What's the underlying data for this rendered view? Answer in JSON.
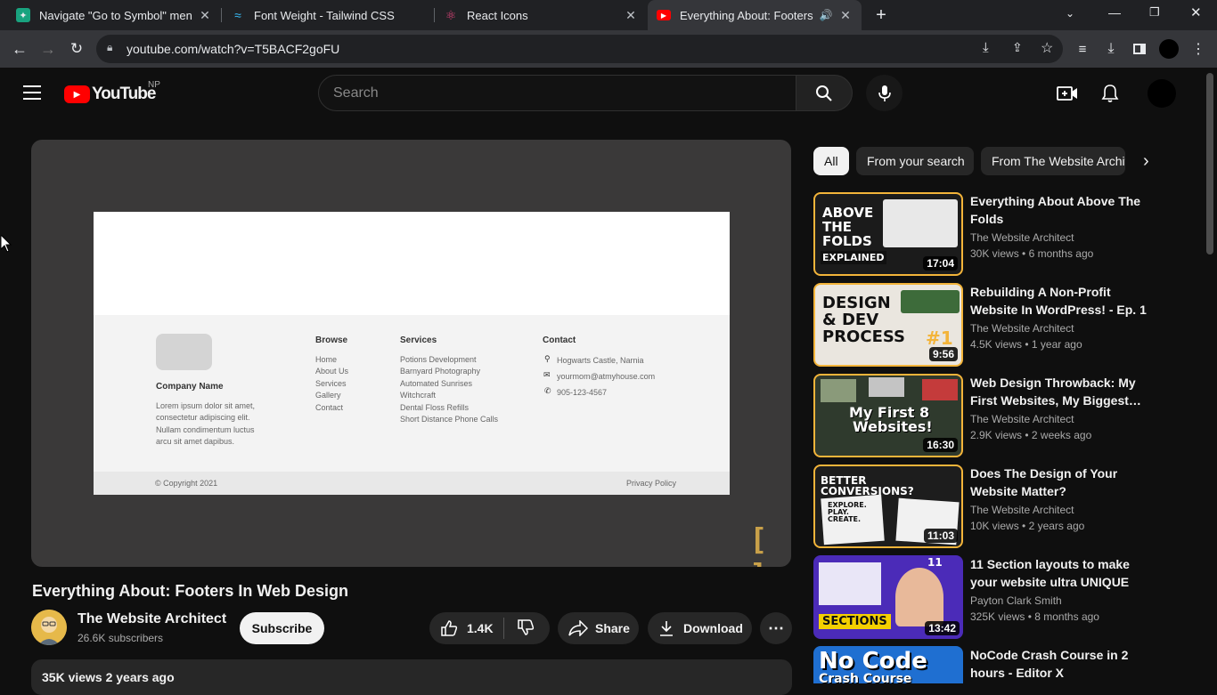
{
  "browser": {
    "tabs": [
      {
        "title": "Navigate \"Go to Symbol\" menu",
        "icon": "chatgpt-icon"
      },
      {
        "title": "Font Weight - Tailwind CSS",
        "icon": "tailwind-icon"
      },
      {
        "title": "React Icons",
        "icon": "react-icon"
      },
      {
        "title": "Everything About: Footers In Web Design",
        "icon": "youtube-icon",
        "active": true
      }
    ],
    "url": "youtube.com/watch?v=T5BACF2goFU"
  },
  "youtube": {
    "logo_text": "YouTube",
    "country": "NP",
    "search_placeholder": "Search"
  },
  "video_slide": {
    "company": "Company Name",
    "lorem": [
      "Lorem ipsum dolor sit amet,",
      "consectetur adipiscing elit.",
      "Nullam condimentum luctus",
      "arcu sit amet dapibus."
    ],
    "browse_title": "Browse",
    "browse": [
      "Home",
      "About Us",
      "Services",
      "Gallery",
      "Contact"
    ],
    "services_title": "Services",
    "services": [
      "Potions Development",
      "Barnyard Photography",
      "Automated Sunrises",
      "Witchcraft",
      "Dental Floss Refills",
      "Short Distance Phone Calls"
    ],
    "contact_title": "Contact",
    "contact": [
      "Hogwarts Castle, Narnia",
      "yourmom@atmyhouse.com",
      "905-123-4567"
    ],
    "copyright": "© Copyright 2021",
    "privacy": "Privacy Policy"
  },
  "video": {
    "title": "Everything About: Footers In Web Design",
    "channel": "The Website Architect",
    "subscribers": "26.6K subscribers",
    "subscribe_label": "Subscribe",
    "likes": "1.4K",
    "share_label": "Share",
    "download_label": "Download",
    "stats": "35K views  2 years ago"
  },
  "chips": [
    "All",
    "From your search",
    "From The Website Architect"
  ],
  "recommendations": [
    {
      "title": "Everything About Above The Folds",
      "channel": "The Website Architect",
      "views": "30K views",
      "age": "6 months ago",
      "duration": "17:04",
      "thumb_lines": [
        "ABOVE",
        "THE",
        "FOLDS"
      ],
      "thumb_tag": "EXPLAINED"
    },
    {
      "title": "Rebuilding A Non-Profit Website In WordPress! - Ep. 1",
      "channel": "The Website Architect",
      "views": "4.5K views",
      "age": "1 year ago",
      "duration": "9:56",
      "thumb_lines": [
        "DESIGN",
        "& DEV",
        "PROCESS"
      ],
      "thumb_tag": "#1"
    },
    {
      "title": "Web Design Throwback: My First Websites, My Biggest…",
      "channel": "The Website Architect",
      "views": "2.9K views",
      "age": "2 weeks ago",
      "duration": "16:30",
      "thumb_lines": [
        "My First 8",
        "Websites!"
      ],
      "thumb_tag": ""
    },
    {
      "title": "Does The Design of Your Website Matter? (Controversia…",
      "channel": "The Website Architect",
      "views": "10K views",
      "age": "2 years ago",
      "duration": "11:03",
      "thumb_lines": [
        "BETTER CONVERSIONS?"
      ],
      "thumb_tag": "EXPLORE. PLAY. CREATE."
    },
    {
      "title": "11 Section layouts to make your website ultra UNIQUE",
      "channel": "Payton Clark Smith",
      "views": "325K views",
      "age": "8 months ago",
      "duration": "13:42",
      "thumb_lines": [
        "11"
      ],
      "thumb_tag": "SECTIONS"
    },
    {
      "title": "NoCode Crash Course in 2 hours - Editor X",
      "channel": "",
      "views": "",
      "age": "",
      "duration": "",
      "thumb_lines": [
        "No Code",
        "Crash Course"
      ],
      "thumb_tag": ""
    }
  ],
  "colors": {
    "youtube_red": "#ff0000",
    "accent_gold": "#c8a049",
    "bg": "#0f0f0f"
  }
}
